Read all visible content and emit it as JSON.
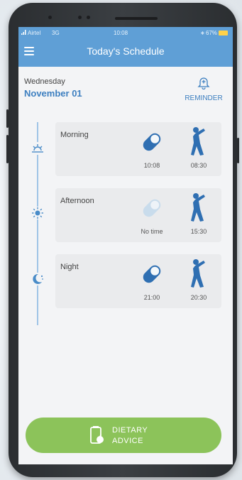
{
  "status_bar": {
    "carrier": "Airtel",
    "network": "3G",
    "time": "10:08",
    "battery": "67%"
  },
  "appbar": {
    "title": "Today's Schedule",
    "menu_icon": "hamburger-menu-icon"
  },
  "date": {
    "weekday": "Wednesday",
    "full": "November 01"
  },
  "reminder": {
    "label": "REMINDER",
    "icon": "bell-plus-icon"
  },
  "schedule": [
    {
      "name": "Morning",
      "timeline_icon": "sunrise-icon",
      "pill_time": "10:08",
      "pill_active": true,
      "exercise_time": "08:30"
    },
    {
      "name": "Afternoon",
      "timeline_icon": "sun-icon",
      "pill_time": "No time",
      "pill_active": false,
      "exercise_time": "15:30"
    },
    {
      "name": "Night",
      "timeline_icon": "moon-stars-icon",
      "pill_time": "21:00",
      "pill_active": true,
      "exercise_time": "20:30"
    }
  ],
  "cta": {
    "line1": "DIETARY",
    "line2": "ADVICE",
    "icon": "apple-jar-icon"
  },
  "colors": {
    "primary": "#5f9fd6",
    "accent_blue": "#3d7fc0",
    "pill_active": "#2f6fb2",
    "pill_inactive": "#c9dcec",
    "cta_green": "#8cc35a"
  }
}
